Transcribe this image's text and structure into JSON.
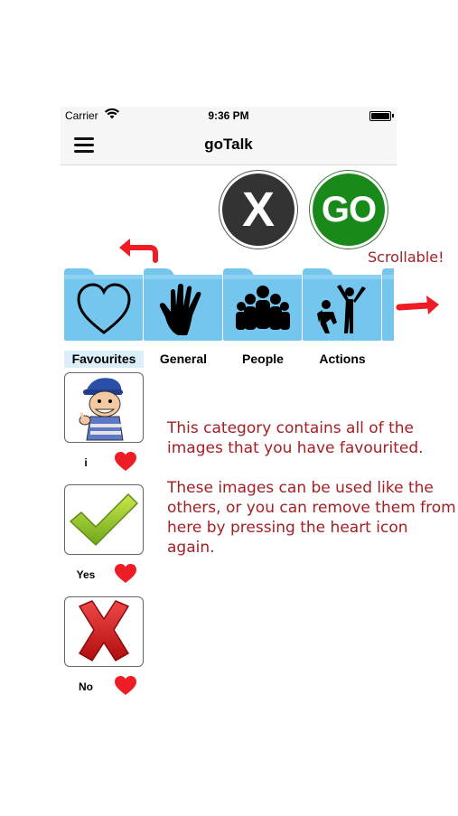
{
  "status_bar": {
    "carrier": "Carrier",
    "time": "9:36 PM"
  },
  "nav": {
    "title": "goTalk",
    "menu_icon": "hamburger-menu-icon"
  },
  "actions": {
    "clear_label": "X",
    "go_label": "GO"
  },
  "annotations": {
    "scrollable": "Scrollable!",
    "paragraph1": "This category contains all of the images that you have favourited.",
    "paragraph2": "These images can be used like the others, or you can remove them from here by pressing the heart icon again."
  },
  "categories": [
    {
      "label": "Favourites",
      "icon": "heart-outline-icon",
      "selected": true
    },
    {
      "label": "General",
      "icon": "hand-icon",
      "selected": false
    },
    {
      "label": "People",
      "icon": "people-group-icon",
      "selected": false
    },
    {
      "label": "Actions",
      "icon": "actions-figures-icon",
      "selected": false
    }
  ],
  "favourites": [
    {
      "label": "i",
      "image": "boy-pointing-self-image",
      "favourited": true
    },
    {
      "label": "Yes",
      "image": "green-checkmark-image",
      "favourited": true
    },
    {
      "label": "No",
      "image": "red-x-image",
      "favourited": true
    }
  ],
  "colors": {
    "folder": "#74c6ef",
    "go_green": "#198a19",
    "annotation_red": "#a31f24",
    "heart_red": "#ee1c24"
  }
}
